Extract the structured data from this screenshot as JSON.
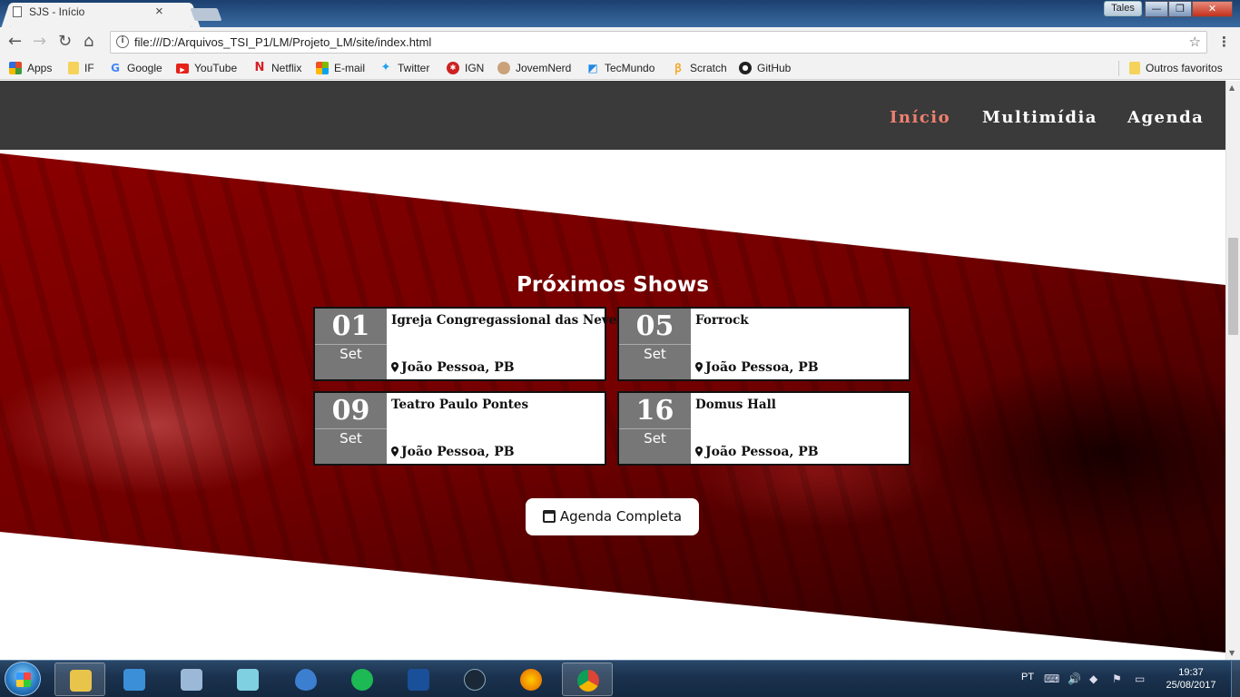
{
  "browser": {
    "tab_title": "SJS - Início",
    "tab_close": "×",
    "user_label": "Tales",
    "window_buttons": {
      "minimize": "—",
      "maximize": "❐",
      "close": "✕"
    },
    "url": "file:///D:/Arquivos_TSI_P1/LM/Projeto_LM/site/index.html"
  },
  "bookmarks": {
    "items": [
      {
        "label": "Apps",
        "icon": "apps-grid-icon",
        "color": "#e04a2a"
      },
      {
        "label": "IF",
        "icon": "folder-icon",
        "color": "#f5d35b"
      },
      {
        "label": "Google",
        "icon": "google-icon",
        "color": "#4285f4"
      },
      {
        "label": "YouTube",
        "icon": "youtube-icon",
        "color": "#e62117"
      },
      {
        "label": "Netflix",
        "icon": "netflix-icon",
        "color": "#d81f26"
      },
      {
        "label": "E-mail",
        "icon": "microsoft-icon",
        "color": "#f25022"
      },
      {
        "label": "Twitter",
        "icon": "twitter-icon",
        "color": "#1da1f2"
      },
      {
        "label": "IGN",
        "icon": "ign-icon",
        "color": "#cc2222"
      },
      {
        "label": "JovemNerd",
        "icon": "jovemnerd-icon",
        "color": "#8a6a4a"
      },
      {
        "label": "TecMundo",
        "icon": "tecmundo-icon",
        "color": "#1e88e5"
      },
      {
        "label": "Scratch",
        "icon": "scratch-icon",
        "color": "#f5a623"
      },
      {
        "label": "GitHub",
        "icon": "github-icon",
        "color": "#222222"
      }
    ],
    "other": "Outros favoritos"
  },
  "site": {
    "nav": [
      {
        "label": "Início",
        "active": true
      },
      {
        "label": "Multimídia",
        "active": false
      },
      {
        "label": "Agenda",
        "active": false
      }
    ],
    "accent_color": "#f08070",
    "section_title": "Próximos Shows",
    "shows": [
      {
        "day": "01",
        "month": "Set",
        "venue": "Igreja Congregassional das Neves",
        "city": "João Pessoa, PB"
      },
      {
        "day": "05",
        "month": "Set",
        "venue": "Forrock",
        "city": "João Pessoa, PB"
      },
      {
        "day": "09",
        "month": "Set",
        "venue": "Teatro Paulo Pontes",
        "city": "João Pessoa, PB"
      },
      {
        "day": "16",
        "month": "Set",
        "venue": "Domus Hall",
        "city": "João Pessoa, PB"
      }
    ],
    "cta_label": "Agenda Completa"
  },
  "taskbar": {
    "apps": [
      {
        "name": "explorer",
        "color": "#e8c44a",
        "pinned": true
      },
      {
        "name": "media-player",
        "color": "#3a8fd8"
      },
      {
        "name": "calculator",
        "color": "#9bb8d8"
      },
      {
        "name": "notes",
        "color": "#7fd0e0"
      },
      {
        "name": "droplet",
        "color": "#3c7fd0"
      },
      {
        "name": "spotify",
        "color": "#1db954"
      },
      {
        "name": "blizzard",
        "color": "#1a4f9a"
      },
      {
        "name": "steam",
        "color": "#1b2838"
      },
      {
        "name": "firefox",
        "color": "#e66000"
      },
      {
        "name": "chrome",
        "color": "#4caf50",
        "pinned": true
      }
    ],
    "lang": "PT",
    "time": "19:37",
    "date": "25/08/2017"
  }
}
